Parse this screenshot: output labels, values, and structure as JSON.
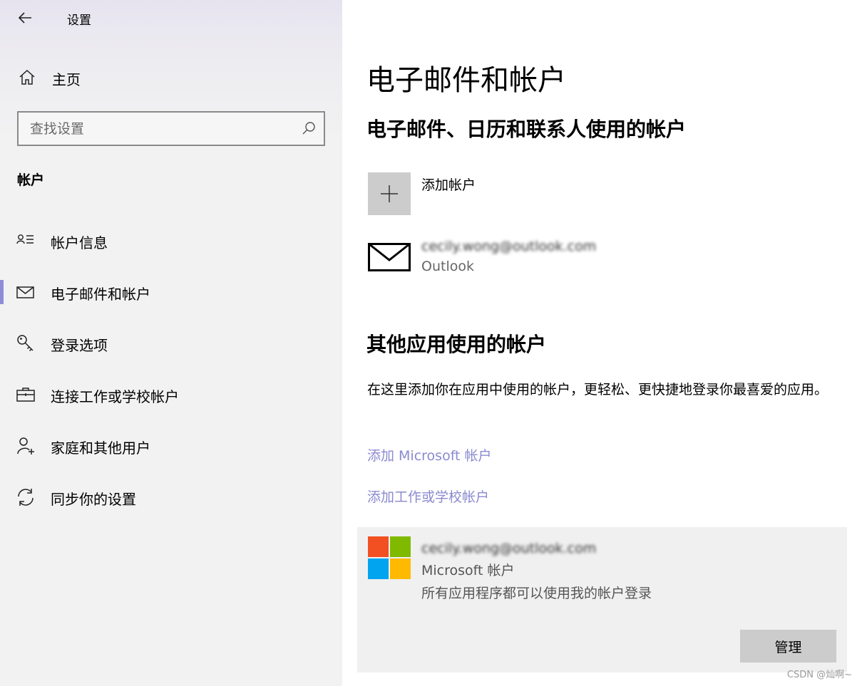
{
  "sidebar": {
    "title": "设置",
    "home_label": "主页",
    "search_placeholder": "查找设置",
    "section_title": "帐户",
    "items": [
      {
        "label": "帐户信息",
        "icon": "account-info-icon"
      },
      {
        "label": "电子邮件和帐户",
        "icon": "mail-icon",
        "active": true
      },
      {
        "label": "登录选项",
        "icon": "key-icon"
      },
      {
        "label": "连接工作或学校帐户",
        "icon": "briefcase-icon"
      },
      {
        "label": "家庭和其他用户",
        "icon": "add-person-icon"
      },
      {
        "label": "同步你的设置",
        "icon": "sync-icon"
      }
    ]
  },
  "main": {
    "title": "电子邮件和帐户",
    "section1_title": "电子邮件、日历和联系人使用的帐户",
    "add_account_label": "添加帐户",
    "outlook_account": {
      "email": "cecily.wong@outlook.com",
      "type": "Outlook"
    },
    "section2_title": "其他应用使用的帐户",
    "section2_desc": "在这里添加你在应用中使用的帐户，更轻松、更快捷地登录你最喜爱的应用。",
    "link_add_ms": "添加 Microsoft 帐户",
    "link_add_work": "添加工作或学校帐户",
    "ms_account": {
      "email": "cecily.wong@outlook.com",
      "type": "Microsoft 帐户",
      "desc": "所有应用程序都可以使用我的帐户登录",
      "manage_label": "管理"
    }
  },
  "colors": {
    "accent": "#8e8cd8",
    "link": "#8a8ad0",
    "ms_red": "#f25022",
    "ms_green": "#7fba00",
    "ms_blue": "#00a4ef",
    "ms_yellow": "#ffb900"
  },
  "watermark": "CSDN @灿啊~"
}
